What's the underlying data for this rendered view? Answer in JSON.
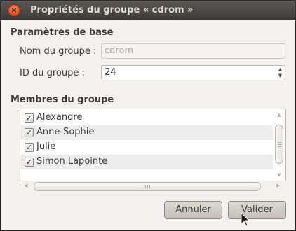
{
  "window": {
    "title": "Propriétés du groupe « cdrom »",
    "close_glyph": "×"
  },
  "basic": {
    "heading": "Paramètres de base",
    "name_label": "Nom du groupe :",
    "name_value": "cdrom",
    "id_label": "ID du groupe :",
    "id_value": "24"
  },
  "members": {
    "heading": "Membres du groupe",
    "items": [
      {
        "label": "Alexandre",
        "checked": true
      },
      {
        "label": "Anne-Sophie",
        "checked": true
      },
      {
        "label": "Julie",
        "checked": true
      },
      {
        "label": "Simon Lapointe",
        "checked": true
      }
    ]
  },
  "buttons": {
    "cancel": "Annuler",
    "ok": "Valider"
  },
  "icons": {
    "checkbox_checked": "check-icon",
    "spin": "spin-arrows-icon",
    "cursor": "mouse-pointer-icon"
  }
}
